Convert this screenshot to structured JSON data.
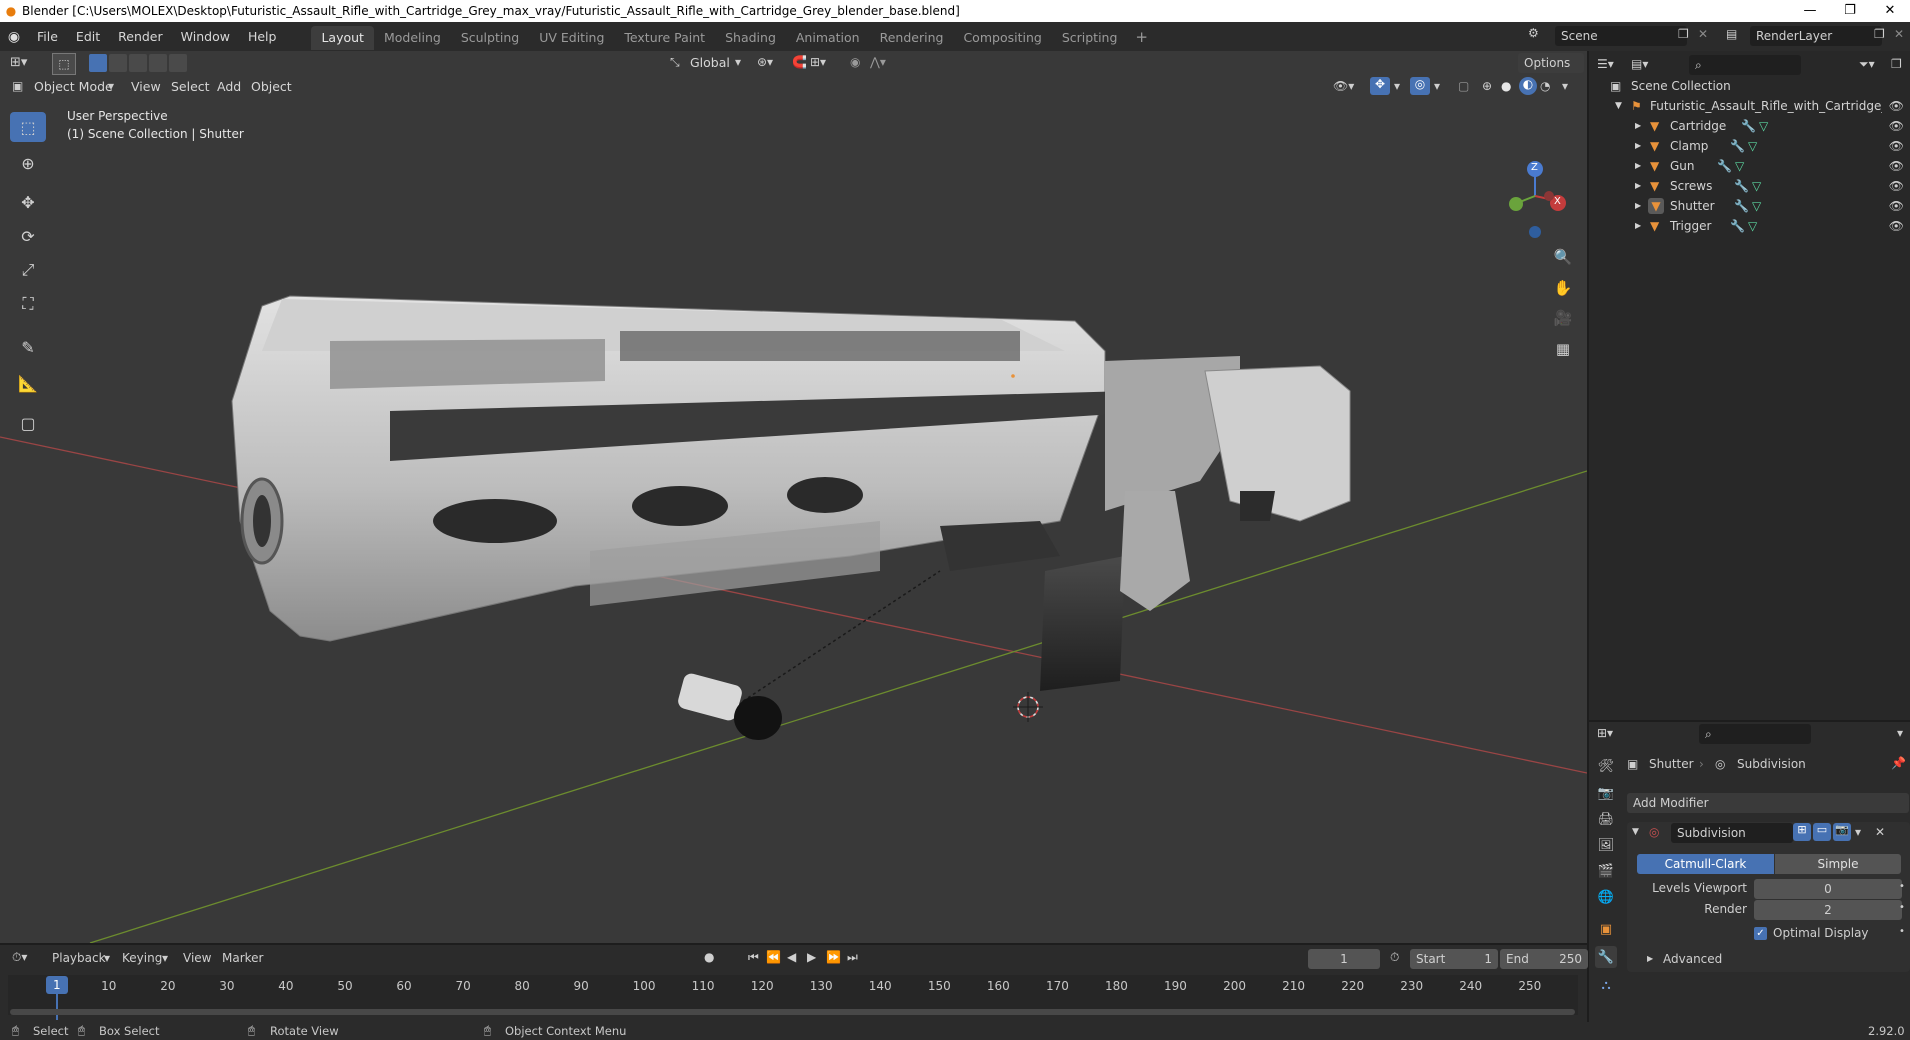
{
  "window": {
    "title": "Blender [C:\\Users\\MOLEX\\Desktop\\Futuristic_Assault_Rifle_with_Cartridge_Grey_max_vray/Futuristic_Assault_Rifle_with_Cartridge_Grey_blender_base.blend]"
  },
  "menu": [
    "File",
    "Edit",
    "Render",
    "Window",
    "Help"
  ],
  "workspaces": [
    "Layout",
    "Modeling",
    "Sculpting",
    "UV Editing",
    "Texture Paint",
    "Shading",
    "Animation",
    "Rendering",
    "Compositing",
    "Scripting"
  ],
  "top_right": {
    "scene": "Scene",
    "render_layer": "RenderLayer"
  },
  "viewport": {
    "orientation": "Global",
    "options": "Options",
    "mode": "Object Mode",
    "menus": [
      "View",
      "Select",
      "Add",
      "Object"
    ],
    "overlay_title": "User Perspective",
    "overlay_sub": "(1) Scene Collection | Shutter",
    "axis_z": "Z",
    "axis_x": "X"
  },
  "outliner": {
    "root": "Scene Collection",
    "collection": "Futuristic_Assault_Rifle_with_Cartridge_Grey",
    "objects": [
      "Cartridge",
      "Clamp",
      "Gun",
      "Screws",
      "Shutter",
      "Trigger"
    ]
  },
  "properties": {
    "object": "Shutter",
    "modifier_ctx": "Subdivision",
    "add_modifier": "Add Modifier",
    "modifier_name": "Subdivision",
    "type_a": "Catmull-Clark",
    "type_b": "Simple",
    "levels_viewport_label": "Levels Viewport",
    "levels_viewport": "0",
    "render_label": "Render",
    "render": "2",
    "optimal_display": "Optimal Display",
    "advanced": "Advanced"
  },
  "timeline": {
    "menus": [
      "Playback",
      "Keying",
      "View",
      "Marker"
    ],
    "current_frame": "1",
    "start_label": "Start",
    "start": "1",
    "end_label": "End",
    "end": "250",
    "ticks": [
      "1",
      "10",
      "20",
      "30",
      "40",
      "50",
      "60",
      "70",
      "80",
      "90",
      "100",
      "110",
      "120",
      "130",
      "140",
      "150",
      "160",
      "170",
      "180",
      "190",
      "200",
      "210",
      "220",
      "230",
      "240",
      "250"
    ]
  },
  "status": {
    "select": "Select",
    "box_select": "Box Select",
    "rotate_view": "Rotate View",
    "context_menu": "Object Context Menu",
    "version": "2.92.0"
  },
  "colors": {
    "accent": "#4772b3",
    "object_icon": "#e8923a",
    "mesh_icon": "#5cd6a0"
  }
}
